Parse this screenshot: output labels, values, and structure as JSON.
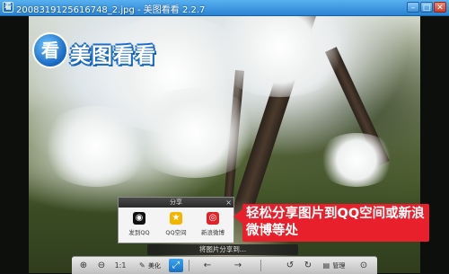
{
  "window": {
    "title": "20083191256167​48_2.jpg - 美图看看 2.2.7",
    "minimize_label": "–",
    "maximize_label": "□",
    "close_label": "✕"
  },
  "logo": {
    "icon_char": "看",
    "text": "美图看看"
  },
  "share_panel": {
    "title": "分享",
    "close_label": "×",
    "items": [
      {
        "label": "发到QQ",
        "icon": "qq-penguin-icon",
        "icon_char": "◉",
        "color": "#111111"
      },
      {
        "label": "QQ空间",
        "icon": "qzone-star-icon",
        "icon_char": "★",
        "color": "#f2b600"
      },
      {
        "label": "新浪微博",
        "icon": "weibo-eye-icon",
        "icon_char": "◎",
        "color": "#e0232a"
      }
    ]
  },
  "callout": {
    "text": "轻松分享图片到QQ空间或新浪微博等处"
  },
  "toolbar": {
    "hint": "将图片分享到...",
    "zoom_in": "⊕",
    "zoom_out": "⊖",
    "actual_size": "1:1",
    "beautify_label": "美化",
    "share": "⤢",
    "prev": "←",
    "next": "→",
    "rotate_left": "↺",
    "rotate_right": "↻",
    "delete": "🗑",
    "manage_label": "管理",
    "more": "⊙"
  },
  "colors": {
    "titlebar": "#2a83d2",
    "callout_red": "#e8202c",
    "active_button": "#1a6fc2"
  }
}
